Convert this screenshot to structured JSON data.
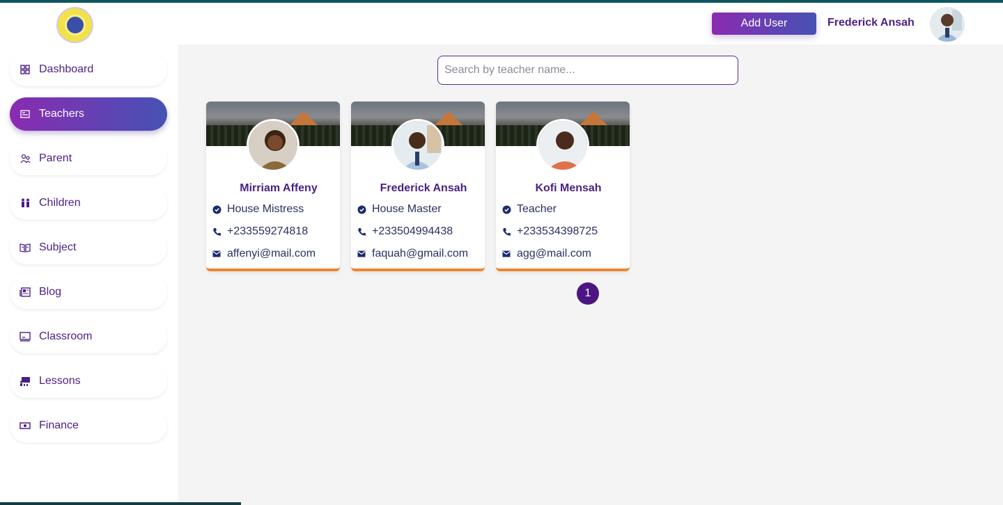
{
  "header": {
    "add_user_label": "Add User",
    "user_name": "Frederick Ansah"
  },
  "sidebar": {
    "items": [
      {
        "label": "Dashboard",
        "icon": "grid-icon"
      },
      {
        "label": "Teachers",
        "icon": "id-card-icon",
        "active": true
      },
      {
        "label": "Parent",
        "icon": "people-icon"
      },
      {
        "label": "Children",
        "icon": "children-icon"
      },
      {
        "label": "Subject",
        "icon": "book-icon"
      },
      {
        "label": "Blog",
        "icon": "newspaper-icon"
      },
      {
        "label": "Classroom",
        "icon": "board-icon"
      },
      {
        "label": "Lessons",
        "icon": "lessons-icon"
      },
      {
        "label": "Finance",
        "icon": "money-icon"
      }
    ]
  },
  "search": {
    "placeholder": "Search by teacher name...",
    "value": ""
  },
  "teachers": [
    {
      "name": "Mirriam Affeny",
      "role": "House Mistress",
      "phone": "+233559274818",
      "email": "affenyi@mail.com"
    },
    {
      "name": "Frederick Ansah",
      "role": "House Master",
      "phone": "+233504994438",
      "email": "faquah@gmail.com"
    },
    {
      "name": "Kofi Mensah",
      "role": "Teacher",
      "phone": "+233534398725",
      "email": "agg@mail.com"
    }
  ],
  "pagination": {
    "current_page": "1"
  },
  "colors": {
    "accent_start": "#8a2bb2",
    "accent_end": "#4652b4",
    "card_border": "#ee8530",
    "text_primary": "#4b1f85"
  }
}
